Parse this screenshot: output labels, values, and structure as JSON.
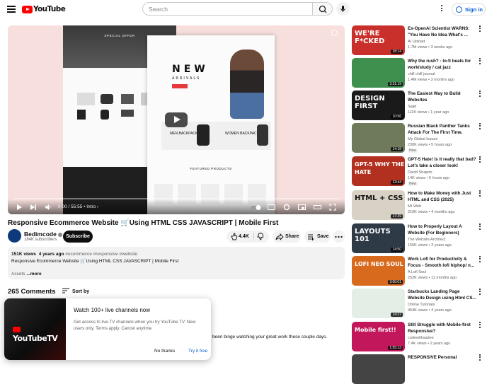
{
  "header": {
    "logo_text": "YouTube",
    "search_placeholder": "Search",
    "signin_label": "Sign in"
  },
  "player": {
    "slide_special": "SPECIAL OFFER",
    "slide_new": "NEW",
    "slide_arrivals": "ARRIVALS",
    "slide_men": "MEN BACKPACK",
    "slide_women": "WOMEN BACKPACK",
    "slide_featured": "FEATURED PRODUCTS",
    "time": "0:00 / 55:55",
    "chapter": "Intro",
    "progress": 0
  },
  "video": {
    "title": "Responsive Ecommerce Website 🛒Using HTML CSS JAVASCRIPT | Mobile First",
    "channel": "Bedimcode",
    "subscribers": "184K subscribers",
    "subscribe_label": "Subscribe",
    "likes": "4.4K",
    "share_label": "Share",
    "save_label": "Save",
    "views": "151K views",
    "age": "4 years ago",
    "tags": "#ecommerce #responsive #website",
    "description": "Responsive Ecommerce Website 🛒Using HTML CSS JAVASCRIPT | Mobile First",
    "assets": "Assets",
    "more": "...more"
  },
  "comments": {
    "count_label": "265 Comments",
    "sort_label": "Sort by",
    "partial_comment": "been binge watching your great work these couple days."
  },
  "popup": {
    "brand": "YouTubeTV",
    "title": "Watch 100+ live channels now",
    "body": "Get access to live TV channels when you try YouTube TV. New users only. Terms apply. Cancel anytime.",
    "no_thanks": "No thanks",
    "try_free": "Try it free"
  },
  "sidebar": [
    {
      "title": "Ex-OpenAI Scientist WARNS: \"You Have No Idea What's ...",
      "channel": "AI Upload",
      "meta": "1.7M views • 3 weeks ago",
      "duration": "18:14",
      "thumb_text": "WE'RE F*CKED",
      "thumb_bg": "#c9302c",
      "new": ""
    },
    {
      "title": "Why the rush? - lo-fi beats for work/study / cat jazz",
      "channel": "chill chill journal",
      "meta": "1.4M views • 3 months ago",
      "duration": "3:31:19",
      "thumb_text": "",
      "thumb_bg": "#3f8f4f",
      "new": ""
    },
    {
      "title": "The Easiest Way to Build Websites",
      "channel": "Sajid",
      "meta": "111K views • 1 year ago",
      "duration": "10:56",
      "thumb_text": "DESIGN FIRST",
      "thumb_bg": "#1a1a1a",
      "new": ""
    },
    {
      "title": "Russian Black Panther Tanks Attack For The First Time.",
      "channel": "My Global Issues",
      "meta": "230K views • 5 hours ago",
      "duration": "14:18",
      "thumb_text": "",
      "thumb_bg": "#6e7a5a",
      "new": "New"
    },
    {
      "title": "GPT-5 Hate! Is it really that bad? Let's take a closer look!",
      "channel": "David Shapiro",
      "meta": "14K views • 5 hours ago",
      "duration": "13:44",
      "thumb_text": "GPT-5 WHY THE HATE",
      "thumb_bg": "#b2301f",
      "new": "New"
    },
    {
      "title": "How to Make Money with Just HTML and CSS (2025)",
      "channel": "Mr Web",
      "meta": "210K views • 4 months ago",
      "duration": "17:29",
      "thumb_text": "HTML + CSS",
      "thumb_bg": "#d8d2c6",
      "new": ""
    },
    {
      "title": "How to Properly Layout A Website (For Beginners)",
      "channel": "The Website Architect",
      "meta": "155K views • 3 years ago",
      "duration": "14:50",
      "thumb_text": "LAYOUTS 101",
      "thumb_bg": "#2f3a47",
      "new": ""
    },
    {
      "title": "Work Lofi for Productivity & Focus - Smooth lofi hiphop/ n...",
      "channel": "A Lofi Soul",
      "meta": "252K views • 11 months ago",
      "duration": "3:00:01",
      "thumb_text": "LOFI NEO SOUL",
      "thumb_bg": "#d86a1e",
      "new": ""
    },
    {
      "title": "Starbucks Landing Page Website Design using Html CS...",
      "channel": "Online Tutorials",
      "meta": "454K views • 4 years ago",
      "duration": "14:37",
      "thumb_text": "",
      "thumb_bg": "#e3efe6",
      "new": ""
    },
    {
      "title": "Still Struggle with Mobile-first Responsive?",
      "channel": "codewithsadee",
      "meta": "7.4K views • 2 years ago",
      "duration": "1:55:13",
      "thumb_text": "Mobile first!!",
      "thumb_bg": "#c2185b",
      "new": ""
    },
    {
      "title": "RESPONSIVE Personal",
      "channel": "",
      "meta": "",
      "duration": "",
      "thumb_text": "",
      "thumb_bg": "#444",
      "new": ""
    }
  ]
}
